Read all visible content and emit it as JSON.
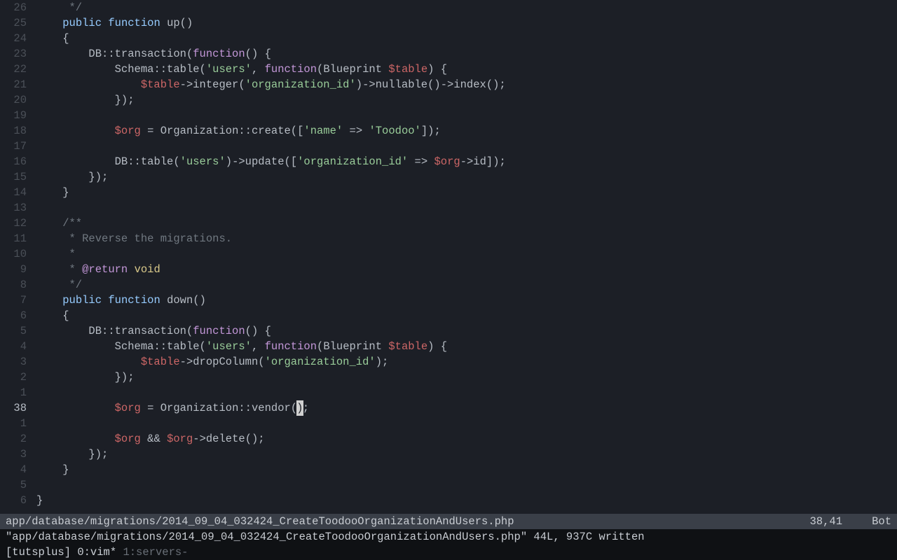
{
  "gutter": [
    "26",
    "25",
    "24",
    "23",
    "22",
    "21",
    "20",
    "19",
    "18",
    "17",
    "16",
    "15",
    "14",
    "13",
    "12",
    "11",
    "10",
    "9",
    "8",
    "7",
    "6",
    "5",
    "4",
    "3",
    "2",
    "1",
    "38",
    "1",
    "2",
    "3",
    "4",
    "5",
    "6"
  ],
  "current_line_index": 26,
  "code_rows": [
    [
      [
        "     */",
        "comm"
      ]
    ],
    [
      [
        "    ",
        "p"
      ],
      [
        "public",
        "kw"
      ],
      [
        " ",
        "p"
      ],
      [
        "function",
        "kw"
      ],
      [
        " up()",
        "p"
      ]
    ],
    [
      [
        "    {",
        "p"
      ]
    ],
    [
      [
        "        DB",
        "p"
      ],
      [
        "::",
        "p"
      ],
      [
        "transaction(",
        "p"
      ],
      [
        "function",
        "fn"
      ],
      [
        "() {",
        "p"
      ]
    ],
    [
      [
        "            Schema",
        "p"
      ],
      [
        "::",
        "p"
      ],
      [
        "table(",
        "p"
      ],
      [
        "'users'",
        "str"
      ],
      [
        ", ",
        "p"
      ],
      [
        "function",
        "fn"
      ],
      [
        "(Blueprint ",
        "p"
      ],
      [
        "$table",
        "var"
      ],
      [
        ") {",
        "p"
      ]
    ],
    [
      [
        "                ",
        "p"
      ],
      [
        "$table",
        "var"
      ],
      [
        "->integer(",
        "p"
      ],
      [
        "'organization_id'",
        "str"
      ],
      [
        ")->nullable()->index();",
        "p"
      ]
    ],
    [
      [
        "            });",
        "p"
      ]
    ],
    [
      [
        "",
        "p"
      ]
    ],
    [
      [
        "            ",
        "p"
      ],
      [
        "$org",
        "var"
      ],
      [
        " = Organization",
        "p"
      ],
      [
        "::",
        "p"
      ],
      [
        "create([",
        "p"
      ],
      [
        "'name'",
        "str"
      ],
      [
        " => ",
        "p"
      ],
      [
        "'Toodoo'",
        "str"
      ],
      [
        "]);",
        "p"
      ]
    ],
    [
      [
        "",
        "p"
      ]
    ],
    [
      [
        "            DB",
        "p"
      ],
      [
        "::",
        "p"
      ],
      [
        "table(",
        "p"
      ],
      [
        "'users'",
        "str"
      ],
      [
        ")->update([",
        "p"
      ],
      [
        "'organization_id'",
        "str"
      ],
      [
        " => ",
        "p"
      ],
      [
        "$org",
        "var"
      ],
      [
        "->id]);",
        "p"
      ]
    ],
    [
      [
        "        });",
        "p"
      ]
    ],
    [
      [
        "    }",
        "p"
      ]
    ],
    [
      [
        "",
        "p"
      ]
    ],
    [
      [
        "    /**",
        "comm"
      ]
    ],
    [
      [
        "     * Reverse the migrations.",
        "comm"
      ]
    ],
    [
      [
        "     *",
        "comm"
      ]
    ],
    [
      [
        "     * ",
        "comm"
      ],
      [
        "@return",
        "mod"
      ],
      [
        " ",
        "comm"
      ],
      [
        "void",
        "type"
      ]
    ],
    [
      [
        "     */",
        "comm"
      ]
    ],
    [
      [
        "    ",
        "p"
      ],
      [
        "public",
        "kw"
      ],
      [
        " ",
        "p"
      ],
      [
        "function",
        "kw"
      ],
      [
        " down()",
        "p"
      ]
    ],
    [
      [
        "    {",
        "p"
      ]
    ],
    [
      [
        "        DB",
        "p"
      ],
      [
        "::",
        "p"
      ],
      [
        "transaction(",
        "p"
      ],
      [
        "function",
        "fn"
      ],
      [
        "() {",
        "p"
      ]
    ],
    [
      [
        "            Schema",
        "p"
      ],
      [
        "::",
        "p"
      ],
      [
        "table(",
        "p"
      ],
      [
        "'users'",
        "str"
      ],
      [
        ", ",
        "p"
      ],
      [
        "function",
        "fn"
      ],
      [
        "(Blueprint ",
        "p"
      ],
      [
        "$table",
        "var"
      ],
      [
        ") {",
        "p"
      ]
    ],
    [
      [
        "                ",
        "p"
      ],
      [
        "$table",
        "var"
      ],
      [
        "->dropColumn(",
        "p"
      ],
      [
        "'organization_id'",
        "str"
      ],
      [
        ");",
        "p"
      ]
    ],
    [
      [
        "            });",
        "p"
      ]
    ],
    [
      [
        "",
        "p"
      ]
    ],
    [
      [
        "            ",
        "p"
      ],
      [
        "$org",
        "var"
      ],
      [
        " = Organization",
        "p"
      ],
      [
        "::",
        "p"
      ],
      [
        "vendor(",
        "p"
      ],
      [
        ")",
        "cursor"
      ],
      [
        ";",
        "p"
      ]
    ],
    [
      [
        "",
        "p"
      ]
    ],
    [
      [
        "            ",
        "p"
      ],
      [
        "$org",
        "var"
      ],
      [
        " && ",
        "p"
      ],
      [
        "$org",
        "var"
      ],
      [
        "->delete();",
        "p"
      ]
    ],
    [
      [
        "        });",
        "p"
      ]
    ],
    [
      [
        "    }",
        "p"
      ]
    ],
    [
      [
        "",
        "p"
      ]
    ],
    [
      [
        "}",
        "p"
      ]
    ]
  ],
  "statusbar": {
    "filepath": "app/database/migrations/2014_09_04_032424_CreateToodooOrganizationAndUsers.php",
    "position": "38,41",
    "scroll": "Bot"
  },
  "message": "\"app/database/migrations/2014_09_04_032424_CreateToodooOrganizationAndUsers.php\" 44L, 937C written",
  "tmux": {
    "session": "[tutsplus]",
    "windows": [
      {
        "idx": "0",
        "name": "vim*",
        "active": true
      },
      {
        "idx": "1",
        "name": "servers-",
        "active": false
      }
    ]
  }
}
